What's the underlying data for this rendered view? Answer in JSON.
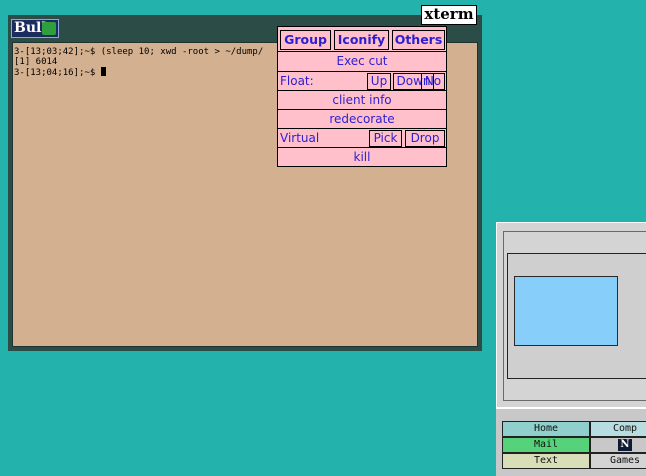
{
  "xterm": {
    "logo_text": "Bull",
    "title": "xterm",
    "lines": [
      "3-[13;03;42];~$ (sleep 10; xwd -root > ~/dump/",
      "[1] 6014",
      "3-[13;04;16];~$ "
    ]
  },
  "menu": {
    "group": "Group",
    "iconify": "Iconify",
    "others": "Others",
    "exec_cut": "Exec cut",
    "float_label": "Float:",
    "up": "Up",
    "down": "Down",
    "no": "No",
    "client_info": "client info",
    "redecorate": "redecorate",
    "virtual_label": "Virtual",
    "pick": "Pick",
    "drop": "Drop",
    "kill": "kill"
  },
  "panel": {
    "home": "Home",
    "comp": "Comp",
    "mail": "Mail",
    "n_icon": "N",
    "text": "Text",
    "games": "Games"
  },
  "colors": {
    "desktop": "#23b3ac",
    "menu_bg": "#ffc0cb",
    "menu_text": "#2d1fd0",
    "terminal_bg": "#d3b08f",
    "pager_window": "#87cefa"
  }
}
